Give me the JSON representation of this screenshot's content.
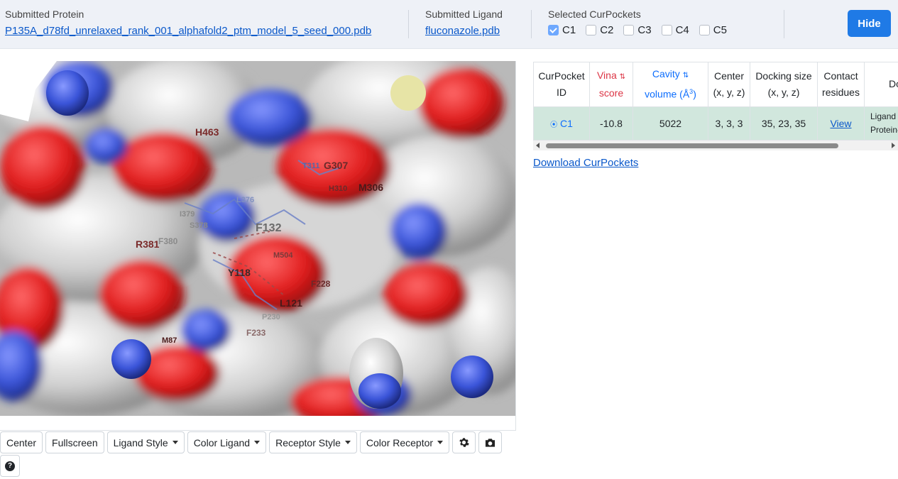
{
  "header": {
    "protein_label": "Submitted Protein",
    "protein_file": "P135A_d78fd_unrelaxed_rank_001_alphafold2_ptm_model_5_seed_000.pdb",
    "ligand_label": "Submitted Ligand",
    "ligand_file": "fluconazole.pdb",
    "pockets_label": "Selected CurPockets",
    "pockets": [
      {
        "label": "C1",
        "checked": true
      },
      {
        "label": "C2",
        "checked": false
      },
      {
        "label": "C3",
        "checked": false
      },
      {
        "label": "C4",
        "checked": false
      },
      {
        "label": "C5",
        "checked": false
      }
    ],
    "hide_label": "Hide"
  },
  "viewer": {
    "residues": [
      "H463",
      "T311",
      "G307",
      "H310",
      "M306",
      "L376",
      "I379",
      "S378",
      "F132",
      "R381",
      "F380",
      "M504",
      "Y118",
      "F228",
      "L121",
      "P230",
      "F233",
      "M87"
    ]
  },
  "toolbar": {
    "center": "Center",
    "fullscreen": "Fullscreen",
    "ligand_style": "Ligand Style",
    "color_ligand": "Color Ligand",
    "receptor_style": "Receptor Style",
    "color_receptor": "Color Receptor",
    "settings_icon": "gear-icon",
    "camera_icon": "camera-icon",
    "help_icon": "question-circle-icon",
    "help_glyph": "?"
  },
  "table": {
    "headers": {
      "id_1": "CurPocket",
      "id_2": "ID",
      "vina_1": "Vina",
      "vina_2": "score",
      "cavity_1": "Cavity",
      "cavity_2": "volume (Å",
      "cavity_sup": "3",
      "cavity_end": ")",
      "center_1": "Center",
      "center_2": "(x, y, z)",
      "docking_1": "Docking size",
      "docking_2": "(x, y, z)",
      "contact_1": "Contact",
      "contact_2": "residues",
      "extra_1": "Do"
    },
    "row": {
      "id": "C1",
      "vina": "-10.8",
      "cavity": "5022",
      "center": "3, 3, 3",
      "docking": "35, 23, 35",
      "contact": "View",
      "extra_1": "Ligand |",
      "extra_2": "Protein-"
    },
    "download": "Download CurPockets"
  }
}
